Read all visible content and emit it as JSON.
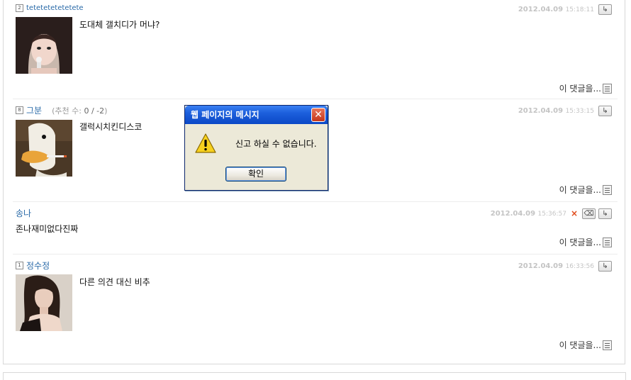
{
  "comments": [
    {
      "level": "2",
      "nick": "tetetetetetetete",
      "date": "2012.04.09",
      "time": "15:18:11",
      "text": "도대체 갤치디가 머냐?",
      "reply_label": "이 댓글을..."
    },
    {
      "level": "8",
      "nick": "그분",
      "recommend_label": "(추천 수:",
      "recommend_value": "0 / -2",
      "recommend_close": ")",
      "date": "2012.04.09",
      "time": "15:33:15",
      "text": "갤럭시치킨디스코",
      "reply_label": "이 댓글을..."
    },
    {
      "nick": "송나",
      "date": "2012.04.09",
      "time": "15:36:57",
      "text": "존나재미없다진짜",
      "reply_label": "이 댓글을..."
    },
    {
      "level": "1",
      "nick": "정수정",
      "date": "2012.04.09",
      "time": "16:33:56",
      "text": "다른 의견 대신 비추",
      "reply_label": "이 댓글을..."
    }
  ],
  "icons": {
    "reply_arrow": "↳",
    "delete": "×",
    "eraser": "⌫"
  },
  "dialog": {
    "title": "웹 페이지의 메시지",
    "message": "신고 하실 수 없습니다.",
    "ok": "확인",
    "close": "✕"
  },
  "colors": {
    "nick": "#2a6aa8",
    "date": "#c4c4c4",
    "dialog_title": "#0b48c6"
  }
}
